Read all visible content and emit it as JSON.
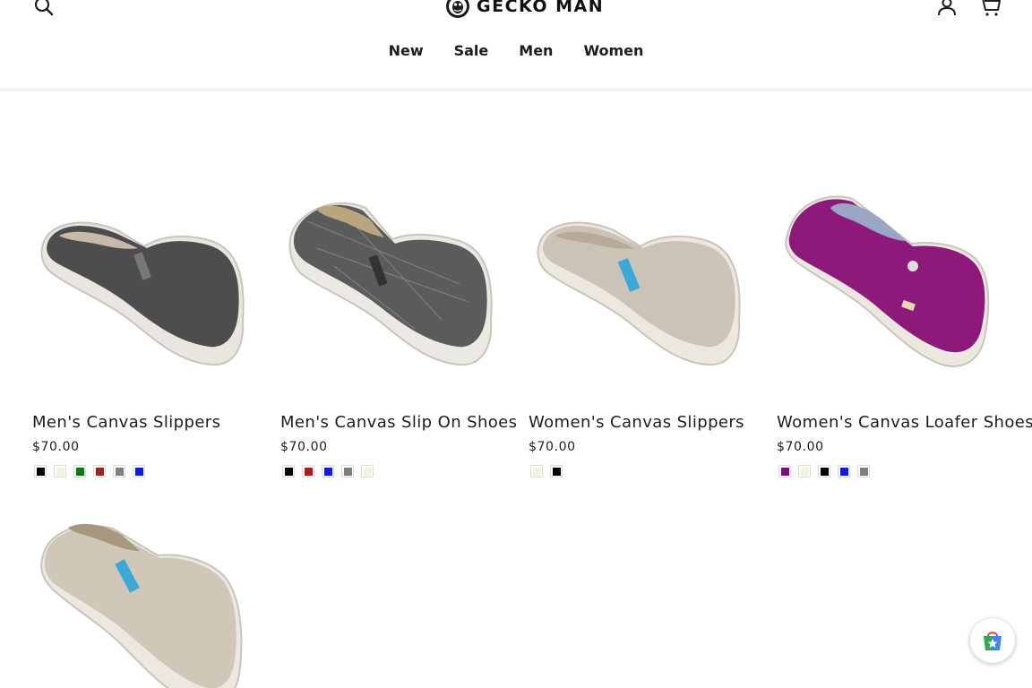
{
  "header": {
    "logo_text": "GECKO MAN",
    "icons": {
      "search": "search-icon",
      "account": "person-icon",
      "cart": "cart-icon"
    }
  },
  "nav": [
    {
      "label": "New"
    },
    {
      "label": "Sale"
    },
    {
      "label": "Men"
    },
    {
      "label": "Women"
    }
  ],
  "products": [
    {
      "title": "Men's Canvas Slippers",
      "price": "$70.00",
      "image": "dark gray canvas slipper",
      "swatches": [
        "#000000",
        "#f5f1dc",
        "#0a7a0a",
        "#a41f1f",
        "#808080",
        "#0b1be0"
      ]
    },
    {
      "title": "Men's Canvas Slip On Shoes",
      "price": "$70.00",
      "image": "plaid gray canvas slip-on shoe",
      "swatches": [
        "#000000",
        "#a41f1f",
        "#0b1be0",
        "#808080",
        "#f5f1dc"
      ]
    },
    {
      "title": "Women's Canvas Slippers",
      "price": "$70.00",
      "image": "beige canvas slipper",
      "swatches": [
        "#f5f1dc",
        "#000000"
      ]
    },
    {
      "title": "Women's Canvas Loafer Shoes",
      "price": "$70.00",
      "image": "magenta canvas loafer",
      "swatches": [
        "#7a0a86",
        "#f5f1dc",
        "#000000",
        "#0b1be0",
        "#808080"
      ]
    },
    {
      "title": "",
      "price": "",
      "image": "beige canvas slip-on shoe",
      "swatches": []
    }
  ],
  "floating_button": {
    "icon": "shopping-bag-star-icon"
  }
}
